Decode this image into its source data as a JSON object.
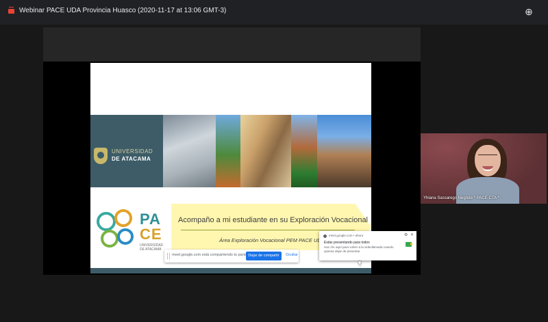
{
  "meeting": {
    "title": "Webinar PACE UDA Provincia Huasco (2020-11-17 at 13:06 GMT-3)"
  },
  "slide": {
    "university_line1": "UNIVERSIDAD",
    "university_line2": "DE ATACAMA",
    "pace_line1": "PA",
    "pace_line2": "CE",
    "pace_subtitle": "UNIVERSIDAD DE ATACAMA",
    "headline": "Acompaño a mi estudiante en su Exploración Vocacional",
    "subline": "Área Exploración Vocacional PEM PACE UDA"
  },
  "share_bar": {
    "message": "meet.google.com está compartiendo tu pantalla.",
    "stop_label": "Dejar de compartir",
    "hide_label": "Ocultar"
  },
  "notification": {
    "source": "meet.google.com • ahora",
    "title": "Estás presentando para todos",
    "body": "Haz clic aquí para volver a la videollamada cuando quieras dejar de presentar"
  },
  "self_view": {
    "name": "Yhiana Sassarego Negrete * PACE-CTA *"
  },
  "colors": {
    "banner": "#3d5c68",
    "pace_teal": "#2f8f96",
    "pace_gold": "#d8a12a",
    "share_blue": "#1a73e8"
  }
}
